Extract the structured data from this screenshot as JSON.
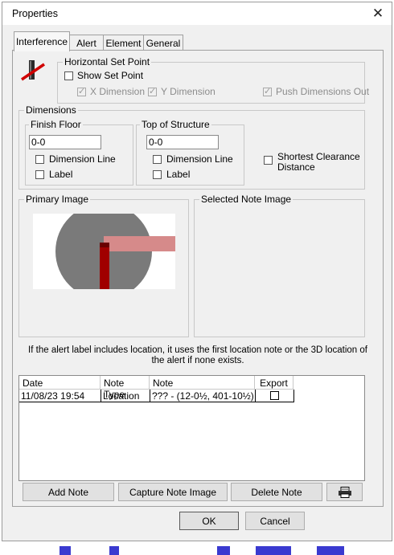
{
  "window": {
    "title": "Properties",
    "close_icon": "close-icon"
  },
  "tabs": [
    {
      "label": "Interference",
      "active": true
    },
    {
      "label": "Alert",
      "active": false
    },
    {
      "label": "Element",
      "active": false
    },
    {
      "label": "General",
      "active": false
    }
  ],
  "horizontal_set_point": {
    "group_label": "Horizontal Set Point",
    "icon": "interference-marker-icon",
    "show_set_point": {
      "label": "Show Set Point",
      "checked": false
    },
    "x_dimension": {
      "label": "X Dimension",
      "checked": true,
      "disabled": true
    },
    "y_dimension": {
      "label": "Y Dimension",
      "checked": true,
      "disabled": true
    },
    "push_dimensions_out": {
      "label": "Push Dimensions Out",
      "checked": true,
      "disabled": true
    }
  },
  "dimensions": {
    "group_label": "Dimensions",
    "finish_floor": {
      "label": "Finish Floor",
      "value": "0-0",
      "dimension_line": {
        "label": "Dimension Line",
        "checked": false
      },
      "label_option": {
        "label": "Label",
        "checked": false
      }
    },
    "top_of_structure": {
      "label": "Top of Structure",
      "value": "0-0",
      "dimension_line": {
        "label": "Dimension Line",
        "checked": false
      },
      "label_option": {
        "label": "Label",
        "checked": false
      }
    },
    "shortest_clearance": {
      "label_line1": "Shortest Clearance",
      "label_line2": "Distance",
      "checked": false
    }
  },
  "images": {
    "primary_label": "Primary Image",
    "selected_note_label": "Selected Note Image"
  },
  "info_text_line1": "If the alert label includes location, it uses the first location note or the 3D location of",
  "info_text_line2": "the alert if none exists.",
  "notes_table": {
    "columns": [
      "Date",
      "Note Type",
      "Note",
      "Export"
    ],
    "rows": [
      {
        "date": "11/08/23 19:54",
        "note_type": "Location",
        "note": "??? - (12-0½, 401-10½)",
        "export": false
      }
    ]
  },
  "buttons": {
    "add_note": "Add Note",
    "capture_note_image": "Capture Note Image",
    "delete_note": "Delete Note",
    "print_icon": "printer-icon"
  },
  "footer": {
    "ok": "OK",
    "cancel": "Cancel"
  },
  "colors": {
    "accent_red": "#c00000",
    "image_gray": "#7a7a7a",
    "pink_beam": "#d68a8a",
    "background_blue": "#3a3ad0"
  }
}
